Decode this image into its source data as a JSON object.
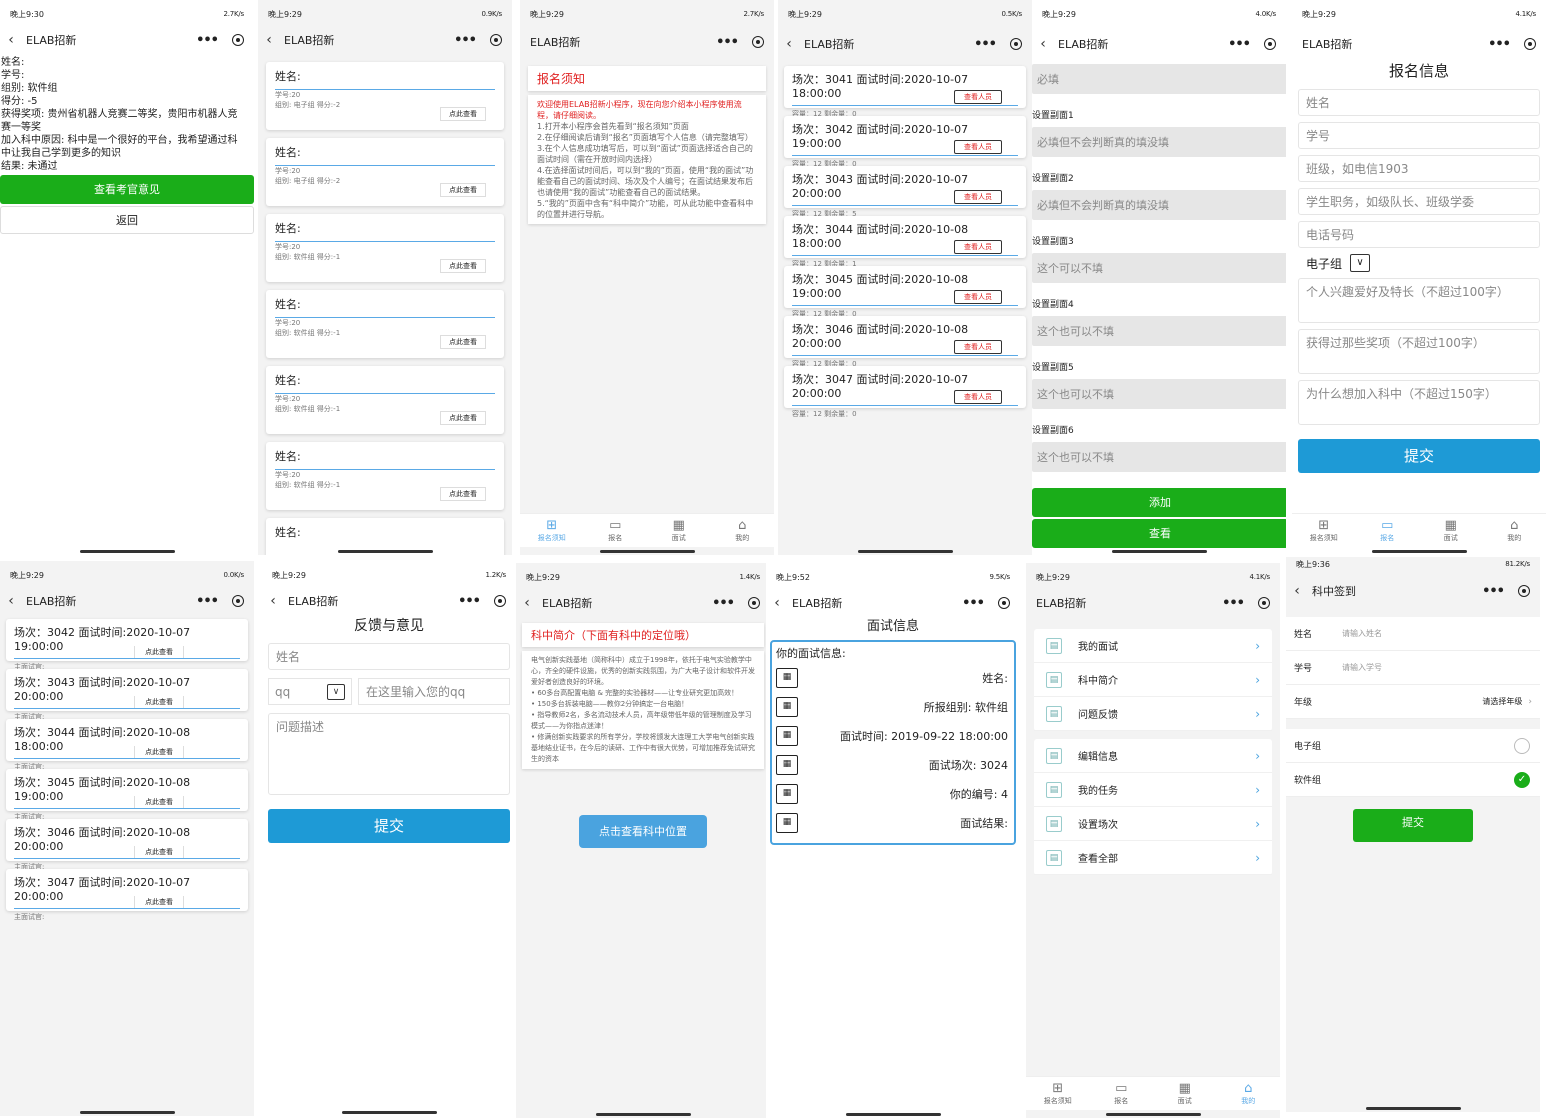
{
  "app_title": "ELAB招新",
  "status": [
    "晚上9:30",
    "晚上9:29",
    "晚上9:29",
    "晚上9:29",
    "晚上9:29",
    "晚上9:29",
    "晚上9:29",
    "晚上9:29",
    "晚上9:29",
    "晚上9:52",
    "晚上9:29",
    "晚上9:36"
  ],
  "speeds": [
    "2.7K/s",
    "0.9K/s",
    "2.7K/s",
    "0.5K/s",
    "4.0K/s",
    "4.1K/s",
    "0.0K/s",
    "1.2K/s",
    "1.4K/s",
    "9.5K/s",
    "4.1K/s",
    "81.2K/s"
  ],
  "s1": {
    "l1": "姓名:",
    "l2": "学号:",
    "l3": "组别: 软件组",
    "l4": "得分: -5",
    "l5": "获得奖项: 贵州省机器人竞赛二等奖，贵阳市机器人竞",
    "l6": "赛一等奖",
    "l7": "加入科中原因: 科中是一个很好的平台，我希望通过科",
    "l8": "中让我自己学到更多的知识",
    "l9": "结果: 未通过",
    "btn1": "查看考官意见",
    "btn2": "返回"
  },
  "s2": {
    "name": "姓名:",
    "sid": "学号:20",
    "look": "点此查看",
    "groups": [
      "组别: 电子组 得分:-2",
      "组别: 电子组 得分:-2",
      "组别: 软件组 得分:-1",
      "组别: 软件组 得分:-1",
      "组别: 软件组 得分:-1",
      "组别: 软件组 得分:-1"
    ]
  },
  "s3": {
    "head": "报名须知",
    "p1": "欢迎使用ELAB招新小程序，现在向您介绍本小程序使用流程，请仔细阅读。",
    "p2": "1.打开本小程序会首先看到“报名须知”页面",
    "p3": "2.在仔细阅读后请到“报名”页面填写个人信息（请完整填写）",
    "p4": "3.在个人信息成功填写后，可以到“面试”页面选择适合自己的面试时间（需在开放时间内选择）",
    "p5": "4.在选择面试时间后，可以到“我的”页面，使用“我的面试”功能查看自己的面试时间、场次及个人编号；在面试结果发布后也请使用“我的面试”功能查看自己的面试结果。",
    "p6": "5.“我的”页面中含有“科中简介”功能，可从此功能中查看科中的位置并进行导航。"
  },
  "tabs": [
    "报名须知",
    "报名",
    "面试",
    "我的"
  ],
  "s4": {
    "sessions": [
      {
        "t": "场次：3041 面试时间:2020-10-07 18:00:00",
        "c": "容量：12 剩余量：0"
      },
      {
        "t": "场次：3042 面试时间:2020-10-07 19:00:00",
        "c": "容量：12 剩余量：0"
      },
      {
        "t": "场次：3043 面试时间:2020-10-07 20:00:00",
        "c": "容量：12 剩余量：5"
      },
      {
        "t": "场次：3044 面试时间:2020-10-08 18:00:00",
        "c": "容量：12 剩余量：1"
      },
      {
        "t": "场次：3045 面试时间:2020-10-08 19:00:00",
        "c": "容量：12 剩余量：0"
      },
      {
        "t": "场次：3046 面试时间:2020-10-08 20:00:00",
        "c": "容量：12 剩余量：0"
      },
      {
        "t": "场次：3047 面试时间:2020-10-07 20:00:00",
        "c": "容量：12 剩余量：0"
      }
    ],
    "btn": "查看人员"
  },
  "s5": {
    "f0": "必填",
    "l1": "设置副面1",
    "f1": "必填但不会判断真的填没填",
    "l2": "设置副面2",
    "f2": "必填但不会判断真的填没填",
    "l3": "设置副面3",
    "f3": "这个可以不填",
    "l4": "设置副面4",
    "f4": "这个也可以不填",
    "l5": "设置副面5",
    "f5": "这个也可以不填",
    "l6": "设置副面6",
    "f6": "这个也可以不填",
    "add": "添加",
    "view": "查看"
  },
  "s6": {
    "title": "报名信息",
    "name": "姓名",
    "sid": "学号",
    "cls": "班级，如电信1903",
    "role": "学生职务，如级队长、班级学委",
    "phone": "电话号码",
    "group": "电子组",
    "hobby": "个人兴趣爱好及特长（不超过100字）",
    "award": "获得过那些奖项（不超过100字）",
    "why": "为什么想加入科中（不超过150字）",
    "submit": "提交"
  },
  "s7": {
    "sessions": [
      "场次：3042 面试时间:2020-10-07 19:00:00",
      "场次：3043 面试时间:2020-10-07 20:00:00",
      "场次：3044 面试时间:2020-10-08 18:00:00",
      "场次：3045 面试时间:2020-10-08 19:00:00",
      "场次：3046 面试时间:2020-10-08 20:00:00",
      "场次：3047 面试时间:2020-10-07 20:00:00"
    ],
    "sub": "主面试官:",
    "look": "点此查看"
  },
  "s8": {
    "title": "反馈与意见",
    "name": "姓名",
    "qq": "qq",
    "qqph": "在这里输入您的qq",
    "desc": "问题描述",
    "submit": "提交"
  },
  "s9": {
    "head": "科中简介（下面有科中的定位哦）",
    "p1": "电气创新实践基地（简称科中）成立于1998年，依托于电气实验教学中心，齐全的硬件设施，优秀的创新实践氛围，为广大电子设计和软件开发爱好者创造良好的环境。",
    "p2": "• 60多台高配置电脑 & 完整的实验器材——让专业研究更加高效！",
    "p3": "• 150多台拆装电脑——教你2分钟搞定一台电脑！",
    "p4": "• 指导教师2名，多名流动技术人员，高年级带低年级的管理制度及学习模式——为你指点迷津！",
    "p5": "• 修满创新实践要求的所有学分，学校将颁发大连理工大学电气创新实践基地结业证书，在今后的读研、工作中有很大优势，可增加推荐免试研究生的资本",
    "btn": "点击查看科中位置"
  },
  "s10": {
    "title": "面试信息",
    "head": "你的面试信息:",
    "rows": [
      "姓名:",
      "所报组别: 软件组",
      "面试时间: 2019-09-22 18:00:00",
      "面试场次: 3024",
      "你的编号: 4",
      "面试结果:"
    ]
  },
  "s11": {
    "items": [
      "我的面试",
      "科中简介",
      "问题反馈",
      "编辑信息",
      "我的任务",
      "设置场次",
      "查看全部"
    ]
  },
  "s12": {
    "title": "科中签到",
    "name": "姓名",
    "nameph": "请输入姓名",
    "sid": "学号",
    "sidph": "请输入学号",
    "grade": "年级",
    "gradeph": "请选择年级",
    "g1": "电子组",
    "g2": "软件组",
    "submit": "提交"
  }
}
